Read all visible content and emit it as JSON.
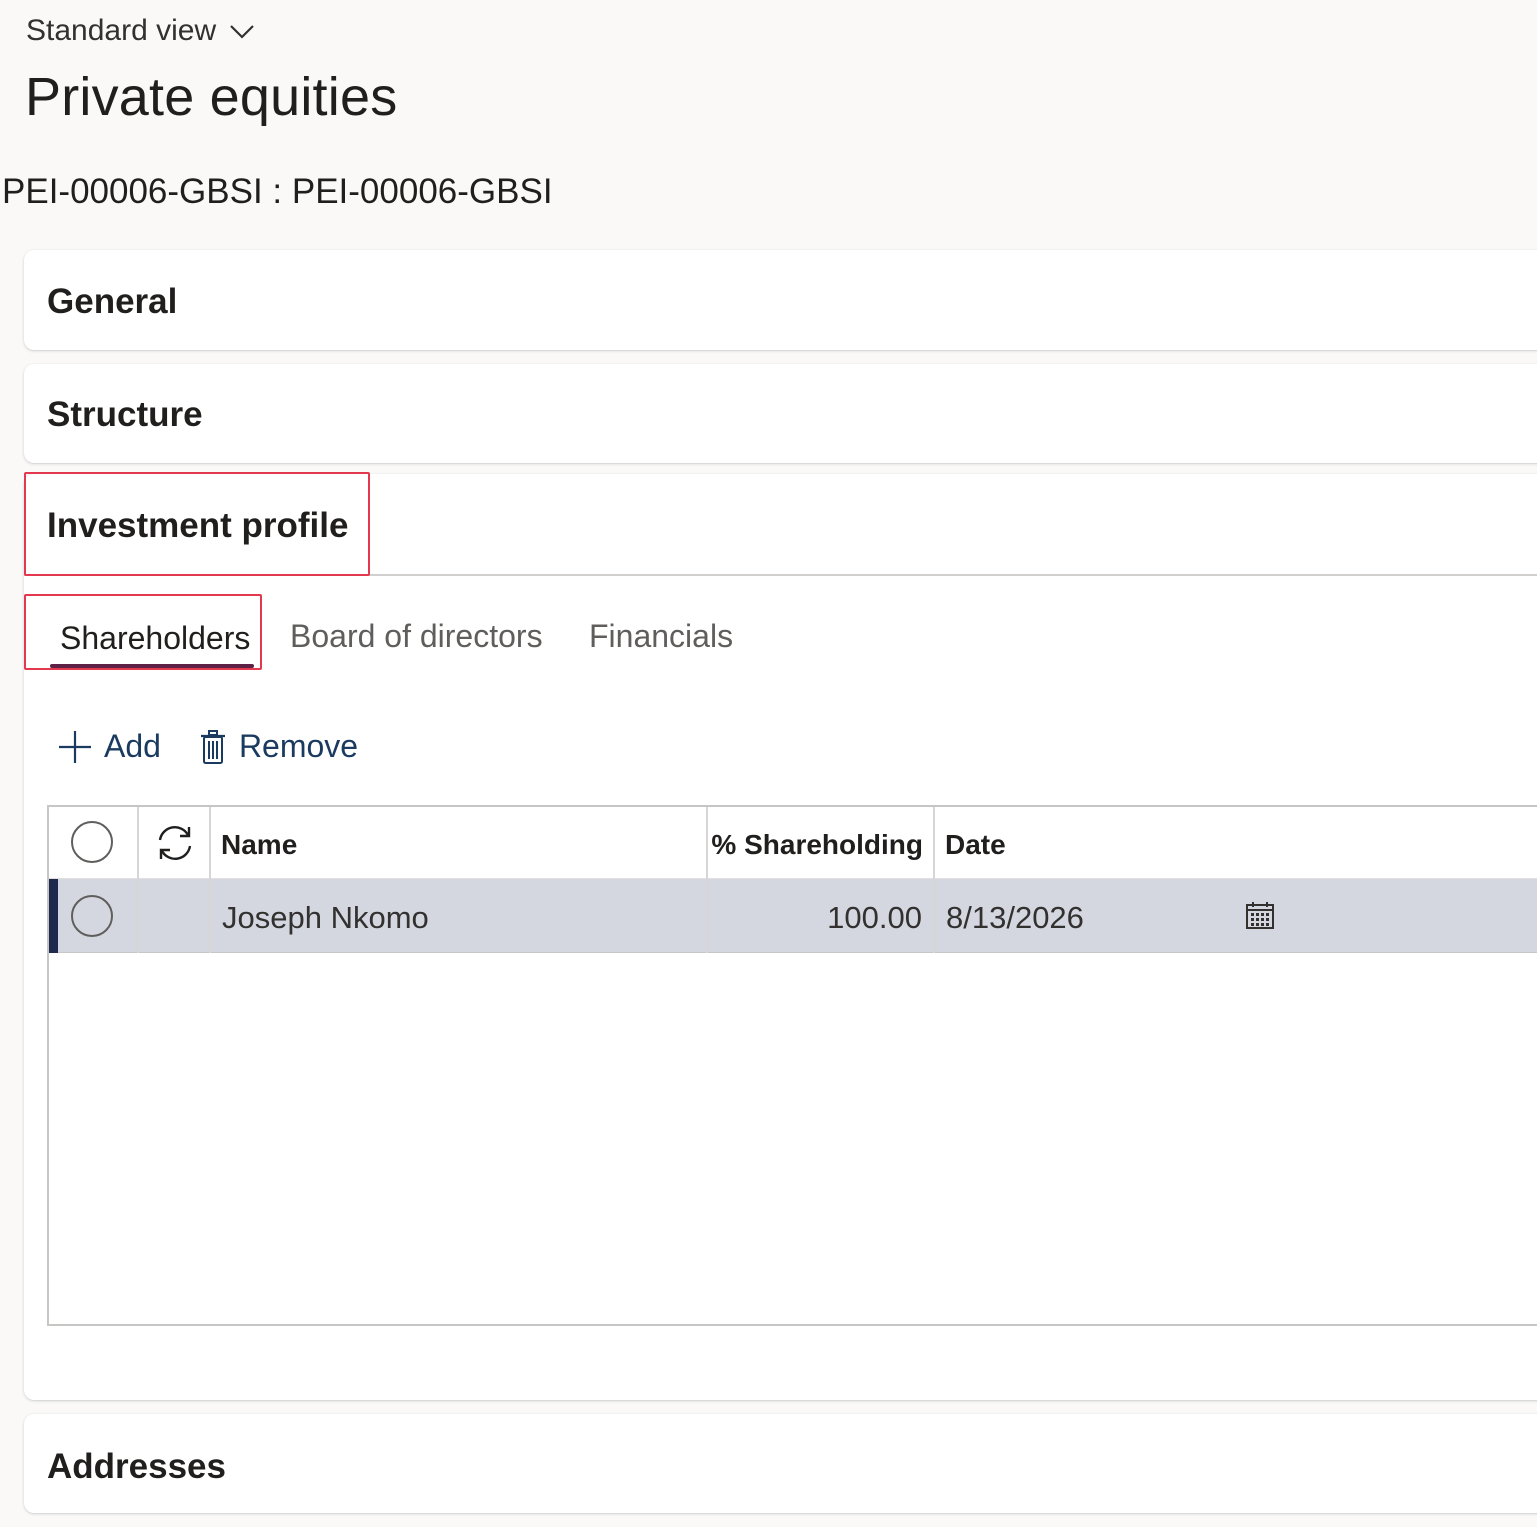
{
  "header": {
    "view_label": "Standard view",
    "page_title": "Private equities",
    "record_id": "PEI-00006-GBSI : PEI-00006-GBSI"
  },
  "sections": {
    "general": "General",
    "structure": "Structure",
    "investment_profile": "Investment profile",
    "addresses": "Addresses"
  },
  "tabs": [
    {
      "label": "Shareholders",
      "selected": true
    },
    {
      "label": "Board of directors",
      "selected": false
    },
    {
      "label": "Financials",
      "selected": false
    }
  ],
  "toolbar": {
    "add_label": "Add",
    "remove_label": "Remove"
  },
  "grid": {
    "columns": {
      "name": "Name",
      "shareholding": "% Shareholding",
      "date": "Date"
    },
    "rows": [
      {
        "name": "Joseph Nkomo",
        "shareholding": "100.00",
        "date": "8/13/2026",
        "selected": true
      }
    ]
  },
  "icons": [
    "chevron-down-icon",
    "plus-icon",
    "trash-icon",
    "refresh-icon",
    "calendar-icon"
  ],
  "colors": {
    "page_bg": "#faf9f8",
    "highlight_border": "#e3394f",
    "tab_underline": "#5c2145",
    "command_text": "#1b3a5f",
    "selected_row_bg": "#d4d7e0",
    "row_indicator": "#1f2a4f"
  }
}
